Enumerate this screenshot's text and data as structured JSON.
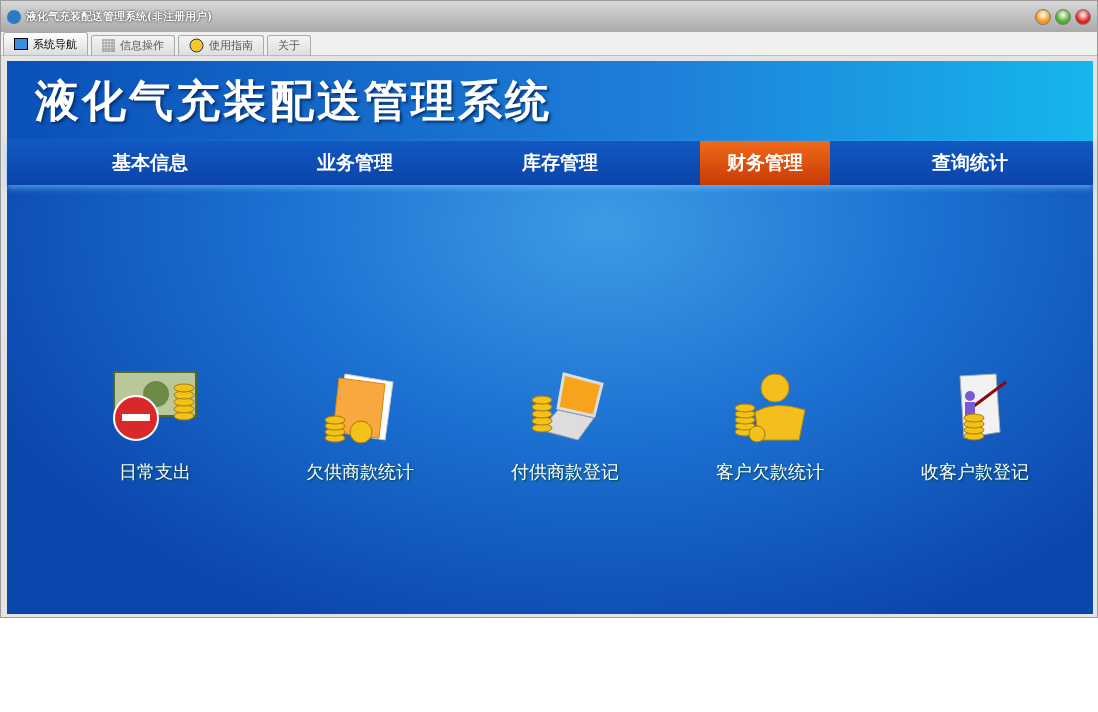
{
  "window": {
    "title": "液化气充装配送管理系统(非注册用户)"
  },
  "tabs": [
    {
      "label": "系统导航",
      "selected": true,
      "kind": "monitor"
    },
    {
      "label": "信息操作",
      "selected": false,
      "kind": "grid"
    },
    {
      "label": "使用指南",
      "selected": false,
      "kind": "help"
    },
    {
      "label": "关于",
      "selected": false,
      "kind": "plain"
    }
  ],
  "banner": {
    "title": "液化气充装配送管理系统"
  },
  "nav": [
    {
      "label": "基本信息",
      "selected": false
    },
    {
      "label": "业务管理",
      "selected": false
    },
    {
      "label": "库存管理",
      "selected": false
    },
    {
      "label": "财务管理",
      "selected": true
    },
    {
      "label": "查询统计",
      "selected": false
    }
  ],
  "functions": [
    {
      "label": "日常支出",
      "kind": "expense"
    },
    {
      "label": "欠供商款统计",
      "kind": "folder"
    },
    {
      "label": "付供商款登记",
      "kind": "laptop"
    },
    {
      "label": "客户欠款统计",
      "kind": "customer"
    },
    {
      "label": "收客户款登记",
      "kind": "scroll"
    }
  ]
}
